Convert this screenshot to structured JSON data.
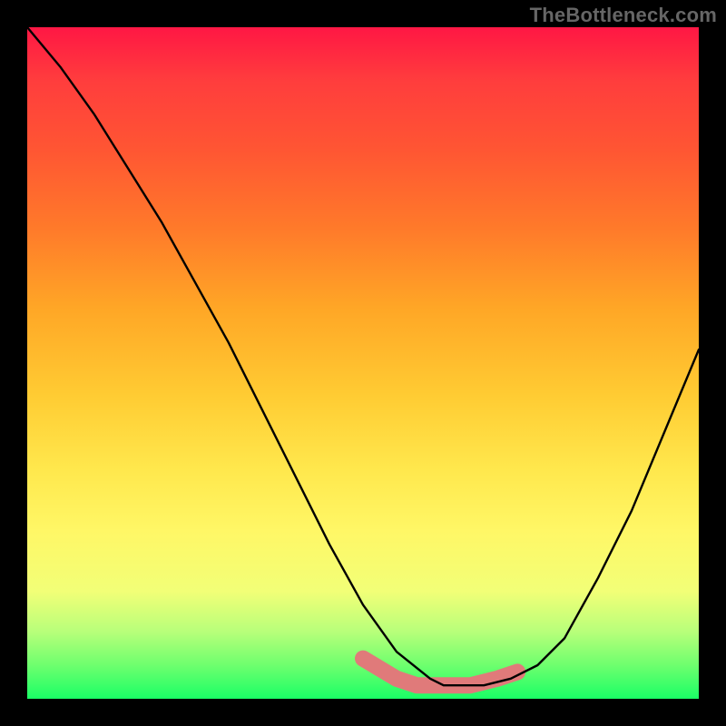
{
  "watermark": "TheBottleneck.com",
  "chart_data": {
    "type": "line",
    "title": "",
    "xlabel": "",
    "ylabel": "",
    "xlim": [
      0,
      100
    ],
    "ylim": [
      0,
      100
    ],
    "grid": false,
    "legend": false,
    "background_gradient": {
      "top": "#ff1744",
      "middle": "#ffe84d",
      "bottom": "#1aff66"
    },
    "series": [
      {
        "name": "bottleneck-curve",
        "color": "#000000",
        "x": [
          0,
          5,
          10,
          15,
          20,
          25,
          30,
          35,
          40,
          45,
          50,
          55,
          60,
          62,
          65,
          68,
          72,
          76,
          80,
          85,
          90,
          95,
          100
        ],
        "y": [
          100,
          94,
          87,
          79,
          71,
          62,
          53,
          43,
          33,
          23,
          14,
          7,
          3,
          2,
          2,
          2,
          3,
          5,
          9,
          18,
          28,
          40,
          52
        ]
      }
    ],
    "highlight": {
      "name": "optimal-zone",
      "color": "#e07a7a",
      "x": [
        50,
        55,
        58,
        62,
        66,
        70,
        73
      ],
      "y": [
        6,
        3,
        2,
        2,
        2,
        3,
        4
      ]
    }
  }
}
